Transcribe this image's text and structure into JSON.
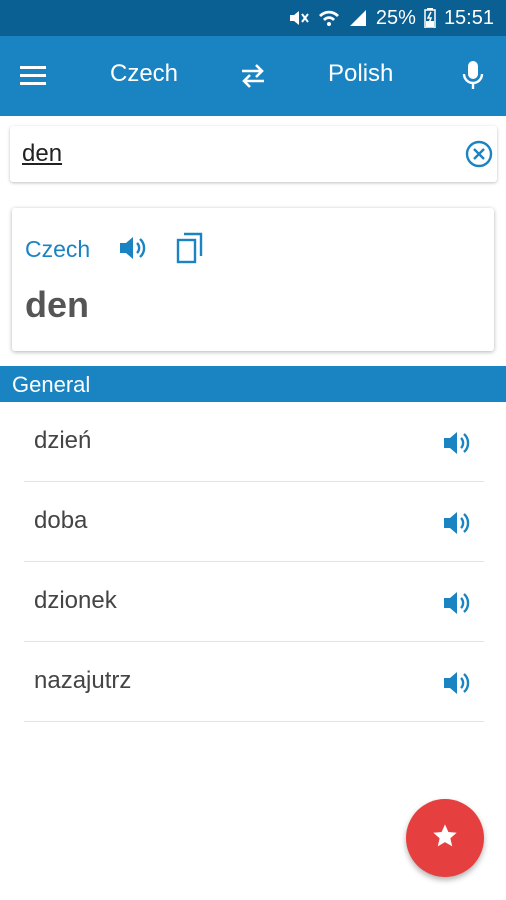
{
  "status_bar": {
    "battery": "25%",
    "time": "15:51"
  },
  "app_bar": {
    "source_language": "Czech",
    "target_language": "Polish"
  },
  "search": {
    "value": "den"
  },
  "card": {
    "language": "Czech",
    "word": "den"
  },
  "section": {
    "title": "General"
  },
  "results": [
    {
      "term": "dzień"
    },
    {
      "term": "doba"
    },
    {
      "term": "dzionek"
    },
    {
      "term": "nazajutrz"
    }
  ],
  "colors": {
    "primary": "#1a83c2",
    "status_bar": "#0a5f93",
    "fab": "#e53f3f"
  },
  "icons": [
    "menu-icon",
    "swap-icon",
    "microphone-icon",
    "clear-icon",
    "speaker-icon",
    "copy-icon",
    "star-icon"
  ]
}
